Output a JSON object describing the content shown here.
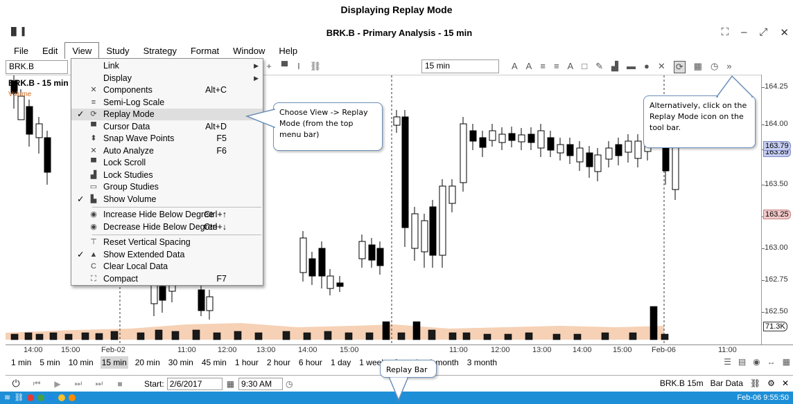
{
  "caption": "Displaying Replay Mode",
  "window": {
    "title": "BRK.B - Primary Analysis - 15 min",
    "app_icon": "bar-chart-icon"
  },
  "menubar": {
    "items": [
      "File",
      "Edit",
      "View",
      "Study",
      "Strategy",
      "Format",
      "Window",
      "Help"
    ],
    "active": "View"
  },
  "toolbar": {
    "symbol": "BRK.B",
    "interval": "15 min"
  },
  "chart": {
    "title": "BRK.B - 15 min",
    "volume_label": "Volume",
    "volume_badge": "Volume",
    "price_ticks": [
      "164.25",
      "164.00",
      "163.75",
      "163.50",
      "163.25",
      "163.00",
      "162.75",
      "162.50"
    ],
    "price_tags": [
      {
        "label": "163.89",
        "color": "#c5cdf0"
      },
      {
        "label": "163.79",
        "color": "#c5cdf0"
      },
      {
        "label": "163.25",
        "color": "#f3c9c9"
      },
      {
        "label": "71.3K",
        "color": "#ffffff"
      }
    ],
    "time_ticks": [
      "14:00",
      "15:00",
      "Feb-02",
      "11:00",
      "12:00",
      "13:00",
      "14:00",
      "15:00",
      "11:00",
      "12:00",
      "13:00",
      "14:00",
      "15:00",
      "Feb-06",
      "11:00"
    ]
  },
  "view_menu": {
    "items": [
      {
        "label": "Link",
        "shortcut": "",
        "check": "",
        "icon": "",
        "submenu": true
      },
      {
        "label": "Display",
        "shortcut": "",
        "check": "",
        "icon": "",
        "submenu": true
      },
      {
        "label": "Components",
        "shortcut": "Alt+C",
        "check": "",
        "icon": "tools-icon"
      },
      {
        "label": "Semi-Log Scale",
        "shortcut": "",
        "check": "",
        "icon": "lines-icon"
      },
      {
        "label": "Replay Mode",
        "shortcut": "",
        "check": "✓",
        "icon": "replay-icon",
        "highlight": true
      },
      {
        "label": "Cursor Data",
        "shortcut": "Alt+D",
        "check": "",
        "icon": "cursor-data-icon"
      },
      {
        "label": "Snap Wave Points",
        "shortcut": "F5",
        "check": "",
        "icon": "snap-icon"
      },
      {
        "label": "Auto Analyze",
        "shortcut": "F6",
        "check": "",
        "icon": "auto-analyze-icon"
      },
      {
        "label": "Lock Scroll",
        "shortcut": "",
        "check": "",
        "icon": "lock-scroll-icon"
      },
      {
        "label": "Lock Studies",
        "shortcut": "",
        "check": "",
        "icon": "lock-studies-icon"
      },
      {
        "label": "Group Studies",
        "shortcut": "",
        "check": "",
        "icon": "group-studies-icon"
      },
      {
        "label": "Show Volume",
        "shortcut": "",
        "check": "✓",
        "icon": "volume-icon"
      },
      {
        "label": "Increase Hide Below Degree",
        "shortcut": "Ctrl+↑",
        "check": "",
        "icon": "eye-icon"
      },
      {
        "label": "Decrease Hide Below Degree",
        "shortcut": "Ctrl+↓",
        "check": "",
        "icon": "eye-icon"
      },
      {
        "label": "Reset Vertical Spacing",
        "shortcut": "",
        "check": "",
        "icon": "reset-spacing-icon"
      },
      {
        "label": "Show Extended Data",
        "shortcut": "",
        "check": "✓",
        "icon": "extended-data-icon"
      },
      {
        "label": "Clear Local Data",
        "shortcut": "",
        "check": "",
        "icon": "clear-data-icon"
      },
      {
        "label": "Compact",
        "shortcut": "F7",
        "check": "",
        "icon": "compact-icon"
      }
    ]
  },
  "callouts": {
    "view": "Choose View -> Replay Mode (from the top menu bar)",
    "toolbar": "Alternatively, click on the Replay Mode icon on the tool bar.",
    "replay": "Replay Bar"
  },
  "intervals": {
    "items": [
      "1 min",
      "5 min",
      "10 min",
      "15 min",
      "20 min",
      "30 min",
      "45 min",
      "1 hour",
      "2 hour",
      "6 hour",
      "1 day",
      "1 week",
      "2 week",
      "1 month",
      "3 month"
    ],
    "active": "15 min"
  },
  "replay_bar": {
    "start_label": "Start:",
    "start_date": "2/6/2017",
    "start_time": "9:30 AM",
    "symbol_info": "BRK.B 15m",
    "data_mode": "Bar Data"
  },
  "status": {
    "time": "Feb-06 9:55:50",
    "dot_colors": [
      "#e53935",
      "#43a047",
      "#1e88e5",
      "#fbc02d",
      "#fb8c00"
    ]
  },
  "colors": {
    "accent": "#1e8fd6",
    "volume_fill": "#f4c9a8",
    "callout_border": "#6b8fb8"
  }
}
